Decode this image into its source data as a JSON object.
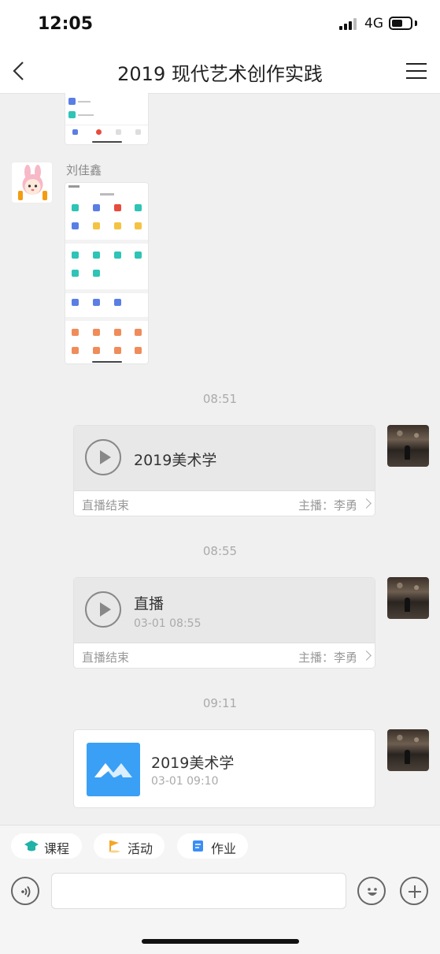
{
  "status_bar": {
    "time": "12:05",
    "network": "4G"
  },
  "nav": {
    "title": "2019 现代艺术创作实践"
  },
  "messages": {
    "sender_name": "刘佳鑫",
    "ts1": "08:51",
    "live1": {
      "title": "2019美术学",
      "status": "直播结束",
      "host": "主播：李勇"
    },
    "ts2": "08:55",
    "live2": {
      "title": "直播",
      "time": "03-01 08:55",
      "status": "直播结束",
      "host": "主播：李勇"
    },
    "ts3": "09:11",
    "course": {
      "title": "2019美术学",
      "time": "03-01 09:10"
    }
  },
  "toolbar": {
    "chips": [
      {
        "label": "课程",
        "icon": "graduation-cap-icon",
        "color": "#20b2a6"
      },
      {
        "label": "活动",
        "icon": "flag-icon",
        "color": "#f5a623"
      },
      {
        "label": "作业",
        "icon": "homework-icon",
        "color": "#3a8ef6"
      }
    ]
  },
  "colors": {
    "accent": "#3aa0f5",
    "background": "#f0f0f0"
  }
}
